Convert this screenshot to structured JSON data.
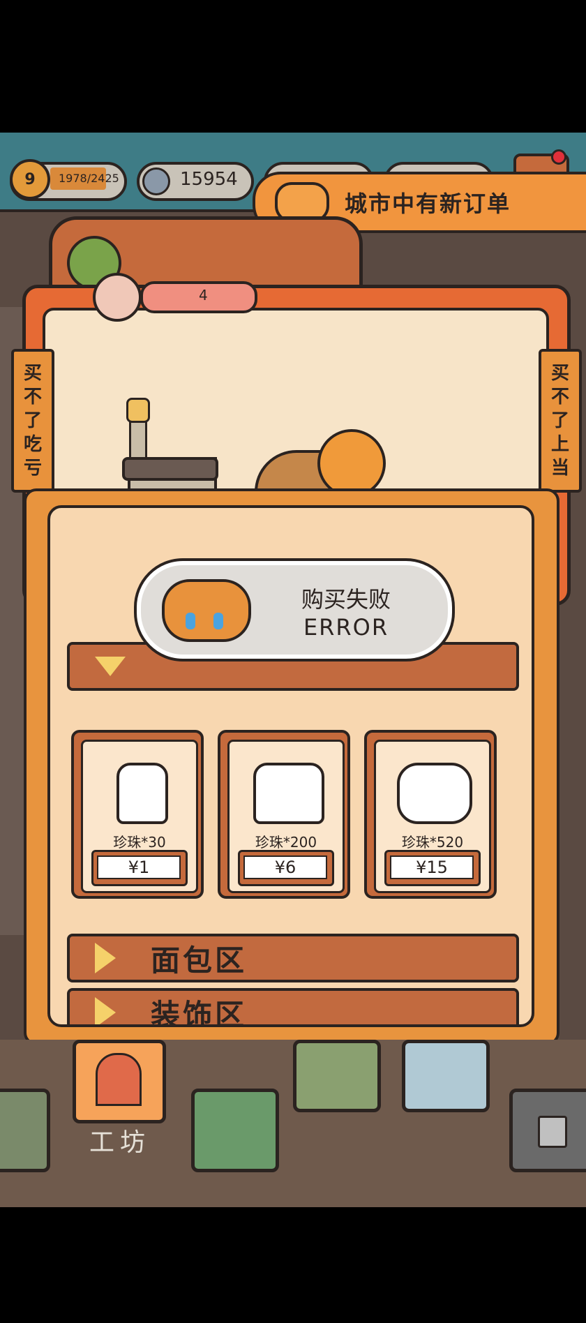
{
  "hud": {
    "level": "9",
    "xp": "1978/2425",
    "coins": "15954",
    "notice": "城市中有新订单",
    "pearl_count": "4"
  },
  "scene": {
    "left_tag": [
      "买",
      "不",
      "了",
      "吃",
      "亏"
    ],
    "right_tag": [
      "买",
      "不",
      "了",
      "上",
      "当"
    ]
  },
  "toast": {
    "line1": "购买失败",
    "line2": "ERROR"
  },
  "shop": {
    "pearl_packs": [
      {
        "qty": "珍珠*30",
        "price": "¥1"
      },
      {
        "qty": "珍珠*200",
        "price": "¥6"
      },
      {
        "qty": "珍珠*520",
        "price": "¥15"
      }
    ],
    "section_bread": "面包区",
    "section_deco": "装饰区"
  },
  "bottom": {
    "workshop_label": "工坊"
  },
  "colors": {
    "orange": "#e8943e",
    "dark_outline": "#2b2320",
    "teal": "#3e7c86"
  }
}
